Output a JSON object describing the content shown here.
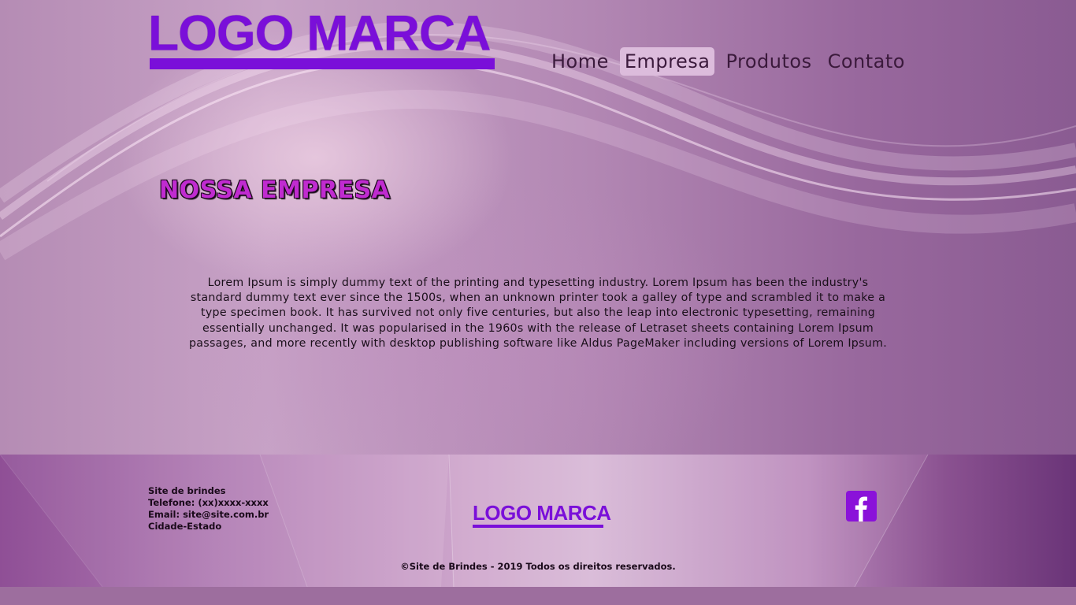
{
  "header": {
    "logo_text": "LOGO MARCA",
    "nav": [
      {
        "label": "Home",
        "active": false
      },
      {
        "label": "Empresa",
        "active": true
      },
      {
        "label": "Produtos",
        "active": false
      },
      {
        "label": "Contato",
        "active": false
      }
    ]
  },
  "main": {
    "title": "NOSSA EMPRESA",
    "body": "Lorem Ipsum is simply dummy text of the printing and typesetting industry. Lorem Ipsum has been the industry's standard dummy text ever since the 1500s, when an unknown printer took a galley of type and scrambled it to make a type specimen book. It has survived not only five centuries, but also the leap into electronic typesetting, remaining essentially unchanged. It was popularised in the 1960s with the release of Letraset sheets containing Lorem Ipsum passages, and more recently with desktop publishing software like Aldus PageMaker including versions of Lorem Ipsum."
  },
  "footer": {
    "contact": {
      "name": "Site de brindes",
      "phone": "Telefone: (xx)xxxx-xxxx",
      "email": "Email: site@site.com.br",
      "city": "Cidade-Estado"
    },
    "logo_text": "LOGO MARCA",
    "social_icon": "facebook-icon",
    "copyright": "©Site de Brindes - 2019 Todos os direitos reservados."
  },
  "colors": {
    "brand": "#7a0fd9",
    "nav_active_bg": "#dcbcdc",
    "title": "#c02bd0",
    "facebook": "#8a12d9"
  }
}
